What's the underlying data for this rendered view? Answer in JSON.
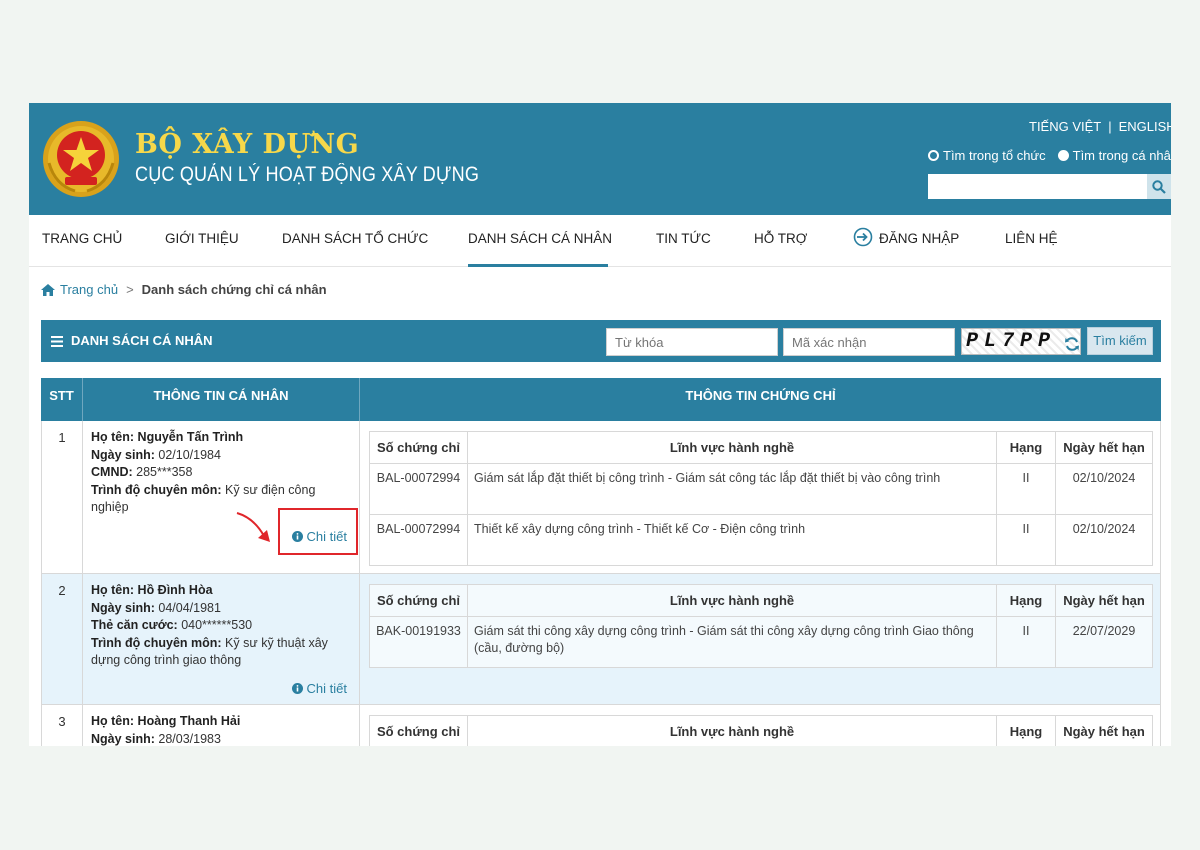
{
  "header": {
    "title_main": "BỘ XÂY DỰNG",
    "title_sub": "CỤC QUẢN LÝ HOẠT ĐỘNG XÂY DỰNG",
    "lang_vi": "TIẾNG VIỆT",
    "lang_sep": "|",
    "lang_en": "ENGLISH",
    "radio_org": "Tìm trong tổ chức",
    "radio_person": "Tìm trong cá nhân",
    "search_value": "",
    "brand_color": "#2a7fa0",
    "title_color": "#f7d84a"
  },
  "nav": {
    "items": [
      "TRANG CHỦ",
      "GIỚI THIỆU",
      "DANH SÁCH TỔ CHỨC",
      "DANH SÁCH CÁ NHÂN",
      "TIN TỨC",
      "HỖ TRỢ",
      "ĐĂNG NHẬP",
      "LIÊN HỆ"
    ],
    "active": "DANH SÁCH CÁ NHÂN"
  },
  "breadcrumb": {
    "home": "Trang chủ",
    "sep": ">",
    "current": "Danh sách chứng chỉ cá nhân"
  },
  "listbar": {
    "title": "DANH SÁCH CÁ NHÂN",
    "keyword_placeholder": "Từ khóa",
    "captcha_placeholder": "Mã xác nhận",
    "captcha_text": "PL7PP",
    "search_label": "Tìm kiếm"
  },
  "table": {
    "col_stt": "STT",
    "col_info": "THÔNG TIN CÁ NHÂN",
    "col_cert": "THÔNG TIN CHỨNG CHỈ",
    "cert_headers": [
      "Số chứng chỉ",
      "Lĩnh vực hành nghề",
      "Hạng",
      "Ngày hết hạn"
    ],
    "detail_label": "Chi tiết",
    "rows": [
      {
        "stt": "1",
        "name_label": "Họ tên:",
        "name": "Nguyễn Tấn Trình",
        "dob_label": "Ngày sinh:",
        "dob": "02/10/1984",
        "id_label": "CMND:",
        "id": "285***358",
        "edu_label": "Trình độ chuyên môn:",
        "edu": "Kỹ sư điện công nghiệp",
        "certs": [
          {
            "no": "BAL-00072994",
            "field": "Giám sát lắp đặt thiết bị công trình - Giám sát công tác lắp đặt thiết bị vào công trình",
            "rank": "II",
            "expiry": "02/10/2024"
          },
          {
            "no": "BAL-00072994",
            "field": "Thiết kế xây dựng công trình - Thiết kế Cơ - Điện công trình",
            "rank": "II",
            "expiry": "02/10/2024"
          }
        ]
      },
      {
        "stt": "2",
        "name_label": "Họ tên:",
        "name": "Hồ Đình Hòa",
        "dob_label": "Ngày sinh:",
        "dob": "04/04/1981",
        "id_label": "Thẻ căn cước:",
        "id": "040******530",
        "edu_label": "Trình độ chuyên môn:",
        "edu": "Kỹ sư kỹ thuật xây dựng công trình giao thông",
        "certs": [
          {
            "no": "BAK-00191933",
            "field": "Giám sát thi công xây dựng công trình - Giám sát thi công xây dựng công trình Giao thông (cầu, đường bộ)",
            "rank": "II",
            "expiry": "22/07/2029"
          }
        ]
      },
      {
        "stt": "3",
        "name_label": "Họ tên:",
        "name": "Hoàng Thanh Hải",
        "dob_label": "Ngày sinh:",
        "dob": "28/03/1983"
      }
    ]
  }
}
